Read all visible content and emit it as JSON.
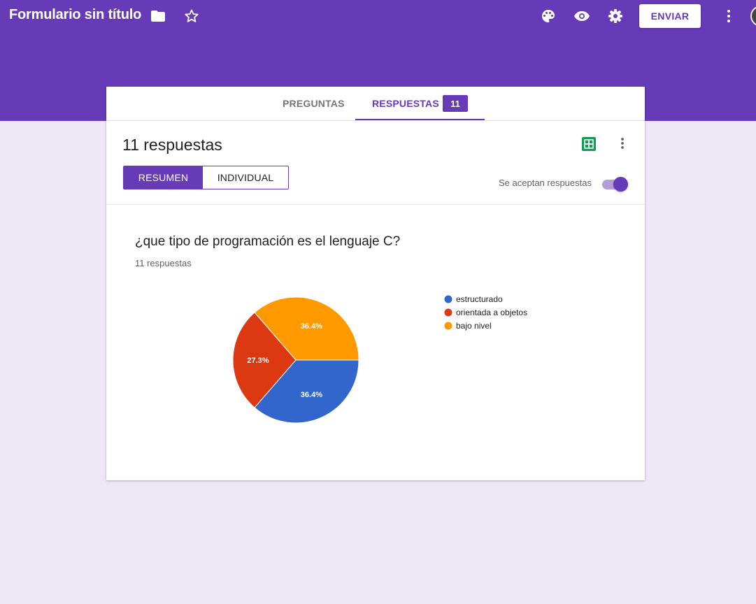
{
  "header": {
    "title": "Formulario sin título",
    "icons": [
      "folder-icon",
      "star-icon",
      "palette-icon",
      "eye-icon",
      "gear-icon",
      "more-vert-icon"
    ],
    "send_label": "ENVIAR",
    "color": "#673ab7"
  },
  "tabs": {
    "questions": "PREGUNTAS",
    "responses": "RESPUESTAS",
    "responses_count": "11"
  },
  "responses": {
    "title": "11 respuestas",
    "summary_label": "RESUMEN",
    "individual_label": "INDIVIDUAL",
    "accepting_label": "Se aceptan respuestas",
    "accepting": true
  },
  "question": {
    "text": "¿que tipo de programación es el lenguaje C?",
    "count_text": "11 respuestas"
  },
  "chart_data": {
    "type": "pie",
    "categories": [
      "estructurado",
      "orientada a objetos",
      "bajo nivel"
    ],
    "values": [
      36.4,
      27.3,
      36.4
    ],
    "labels": [
      "36.4%",
      "27.3%",
      "36.4%"
    ],
    "colors": [
      "#3366cc",
      "#dc3912",
      "#ff9900"
    ],
    "legend": "right"
  }
}
